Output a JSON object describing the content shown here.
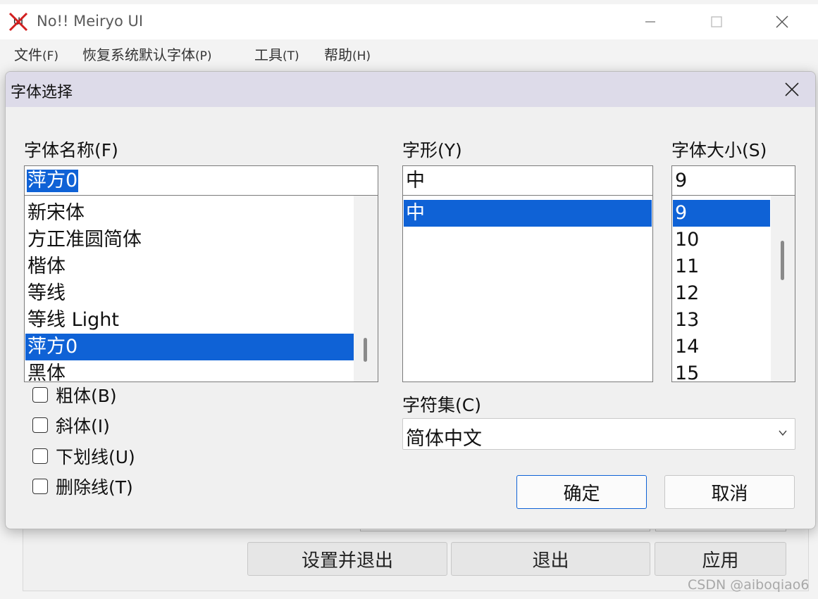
{
  "main_window": {
    "title": "No!! Meiryo UI",
    "menu": [
      {
        "label": "文件",
        "accel": "(F)"
      },
      {
        "label": "恢复系统默认字体",
        "accel": "(P)"
      },
      {
        "label": "工具",
        "accel": "(T)"
      },
      {
        "label": "帮助",
        "accel": "(H)"
      }
    ],
    "buttons": {
      "set_and_exit": "设置并退出",
      "exit": "退出",
      "apply": "应用"
    }
  },
  "dialog": {
    "title": "字体选择",
    "font_name": {
      "label": "字体名称(F)",
      "value": "萍方0",
      "items": [
        "新宋体",
        "方正准圆简体",
        "楷体",
        "等线",
        "等线 Light",
        "萍方0",
        "黑体"
      ],
      "selected_index": 5
    },
    "font_style": {
      "label": "字形(Y)",
      "value": "中",
      "items": [
        "中"
      ],
      "selected_index": 0
    },
    "font_size": {
      "label": "字体大小(S)",
      "value": "9",
      "items": [
        "9",
        "10",
        "11",
        "12",
        "13",
        "14",
        "15"
      ],
      "selected_index": 0
    },
    "effects": [
      {
        "label": "粗体(B)",
        "checked": false
      },
      {
        "label": "斜体(I)",
        "checked": false
      },
      {
        "label": "下划线(U)",
        "checked": false
      },
      {
        "label": "删除线(T)",
        "checked": false
      }
    ],
    "charset": {
      "label": "字符集(C)",
      "value": "简体中文"
    },
    "buttons": {
      "ok": "确定",
      "cancel": "取消"
    }
  },
  "watermark": "CSDN @aiboqiao6",
  "colors": {
    "selection": "#0f62d6",
    "dialog_title_bg": "#dddbe9",
    "window_bg": "#f0f0f0"
  }
}
